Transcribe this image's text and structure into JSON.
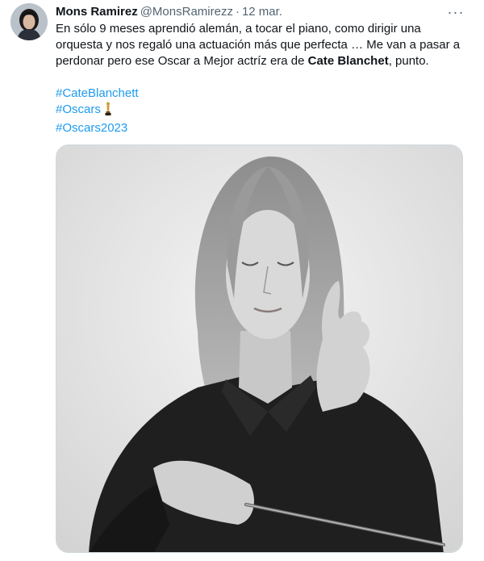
{
  "tweet": {
    "author_name": "Mons Ramirez",
    "author_handle": "@MonsRamirezz",
    "separator": "·",
    "date": "12 mar.",
    "more_glyph": "···",
    "text_before_bold": "En sólo 9 meses aprendió alemán, a tocar el piano, como dirigir una orquesta y nos regaló una actuación más que perfecta … Me van a pasar a perdonar pero ese Oscar a Mejor actríz era de ",
    "text_bold": "Cate Blanchet",
    "text_after_bold": ", punto.",
    "hashtags": [
      "#CateBlanchett",
      "#Oscars",
      "#Oscars2023"
    ],
    "oscar_emoji_icon": "oscar-trophy-icon",
    "media_icon": "photo-conductor-with-baton"
  },
  "colors": {
    "text": "#0f1419",
    "secondary": "#536471",
    "link": "#1d9bf0",
    "border": "#cfd9de"
  }
}
